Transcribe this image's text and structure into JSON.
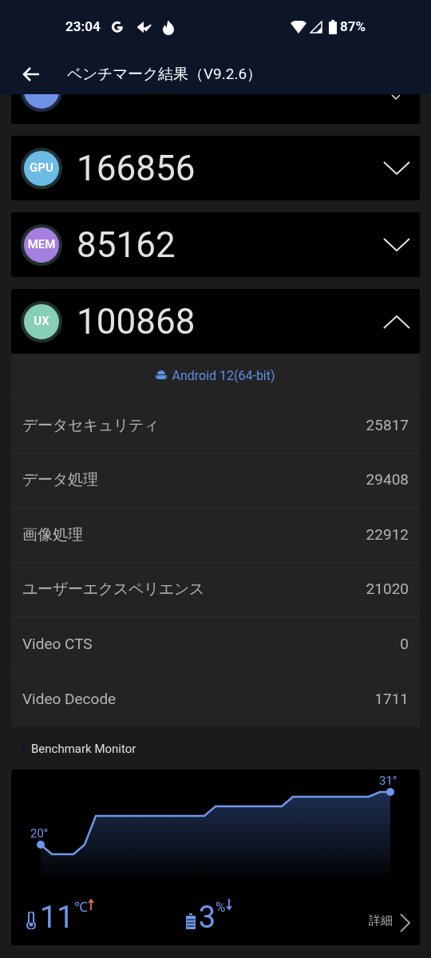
{
  "status_bar": {
    "time": "23:04",
    "battery": "87%"
  },
  "header": {
    "title": "ベンチマーク結果（V9.2.6）"
  },
  "scores": [
    {
      "badge": "GPU",
      "score": "166856",
      "color": "#6bbbe6",
      "expanded": false
    },
    {
      "badge": "MEM",
      "score": "85162",
      "color": "#a57ee0",
      "expanded": false
    },
    {
      "badge": "UX",
      "score": "100868",
      "color": "#86cfb6",
      "expanded": true
    }
  ],
  "details": {
    "platform": "Android 12(64-bit)",
    "rows": [
      {
        "label": "データセキュリティ",
        "value": "25817"
      },
      {
        "label": "データ処理",
        "value": "29408"
      },
      {
        "label": "画像処理",
        "value": "22912"
      },
      {
        "label": "ユーザーエクスペリエンス",
        "value": "21020"
      },
      {
        "label": "Video CTS",
        "value": "0"
      },
      {
        "label": "Video Decode",
        "value": "1711"
      }
    ]
  },
  "monitor": {
    "title": "Benchmark Monitor",
    "start_label": "20°",
    "end_label": "31°",
    "temp_rise": "11",
    "temp_unit": "℃",
    "battery_drop": "3",
    "battery_unit": "%",
    "details_link": "詳細"
  }
}
